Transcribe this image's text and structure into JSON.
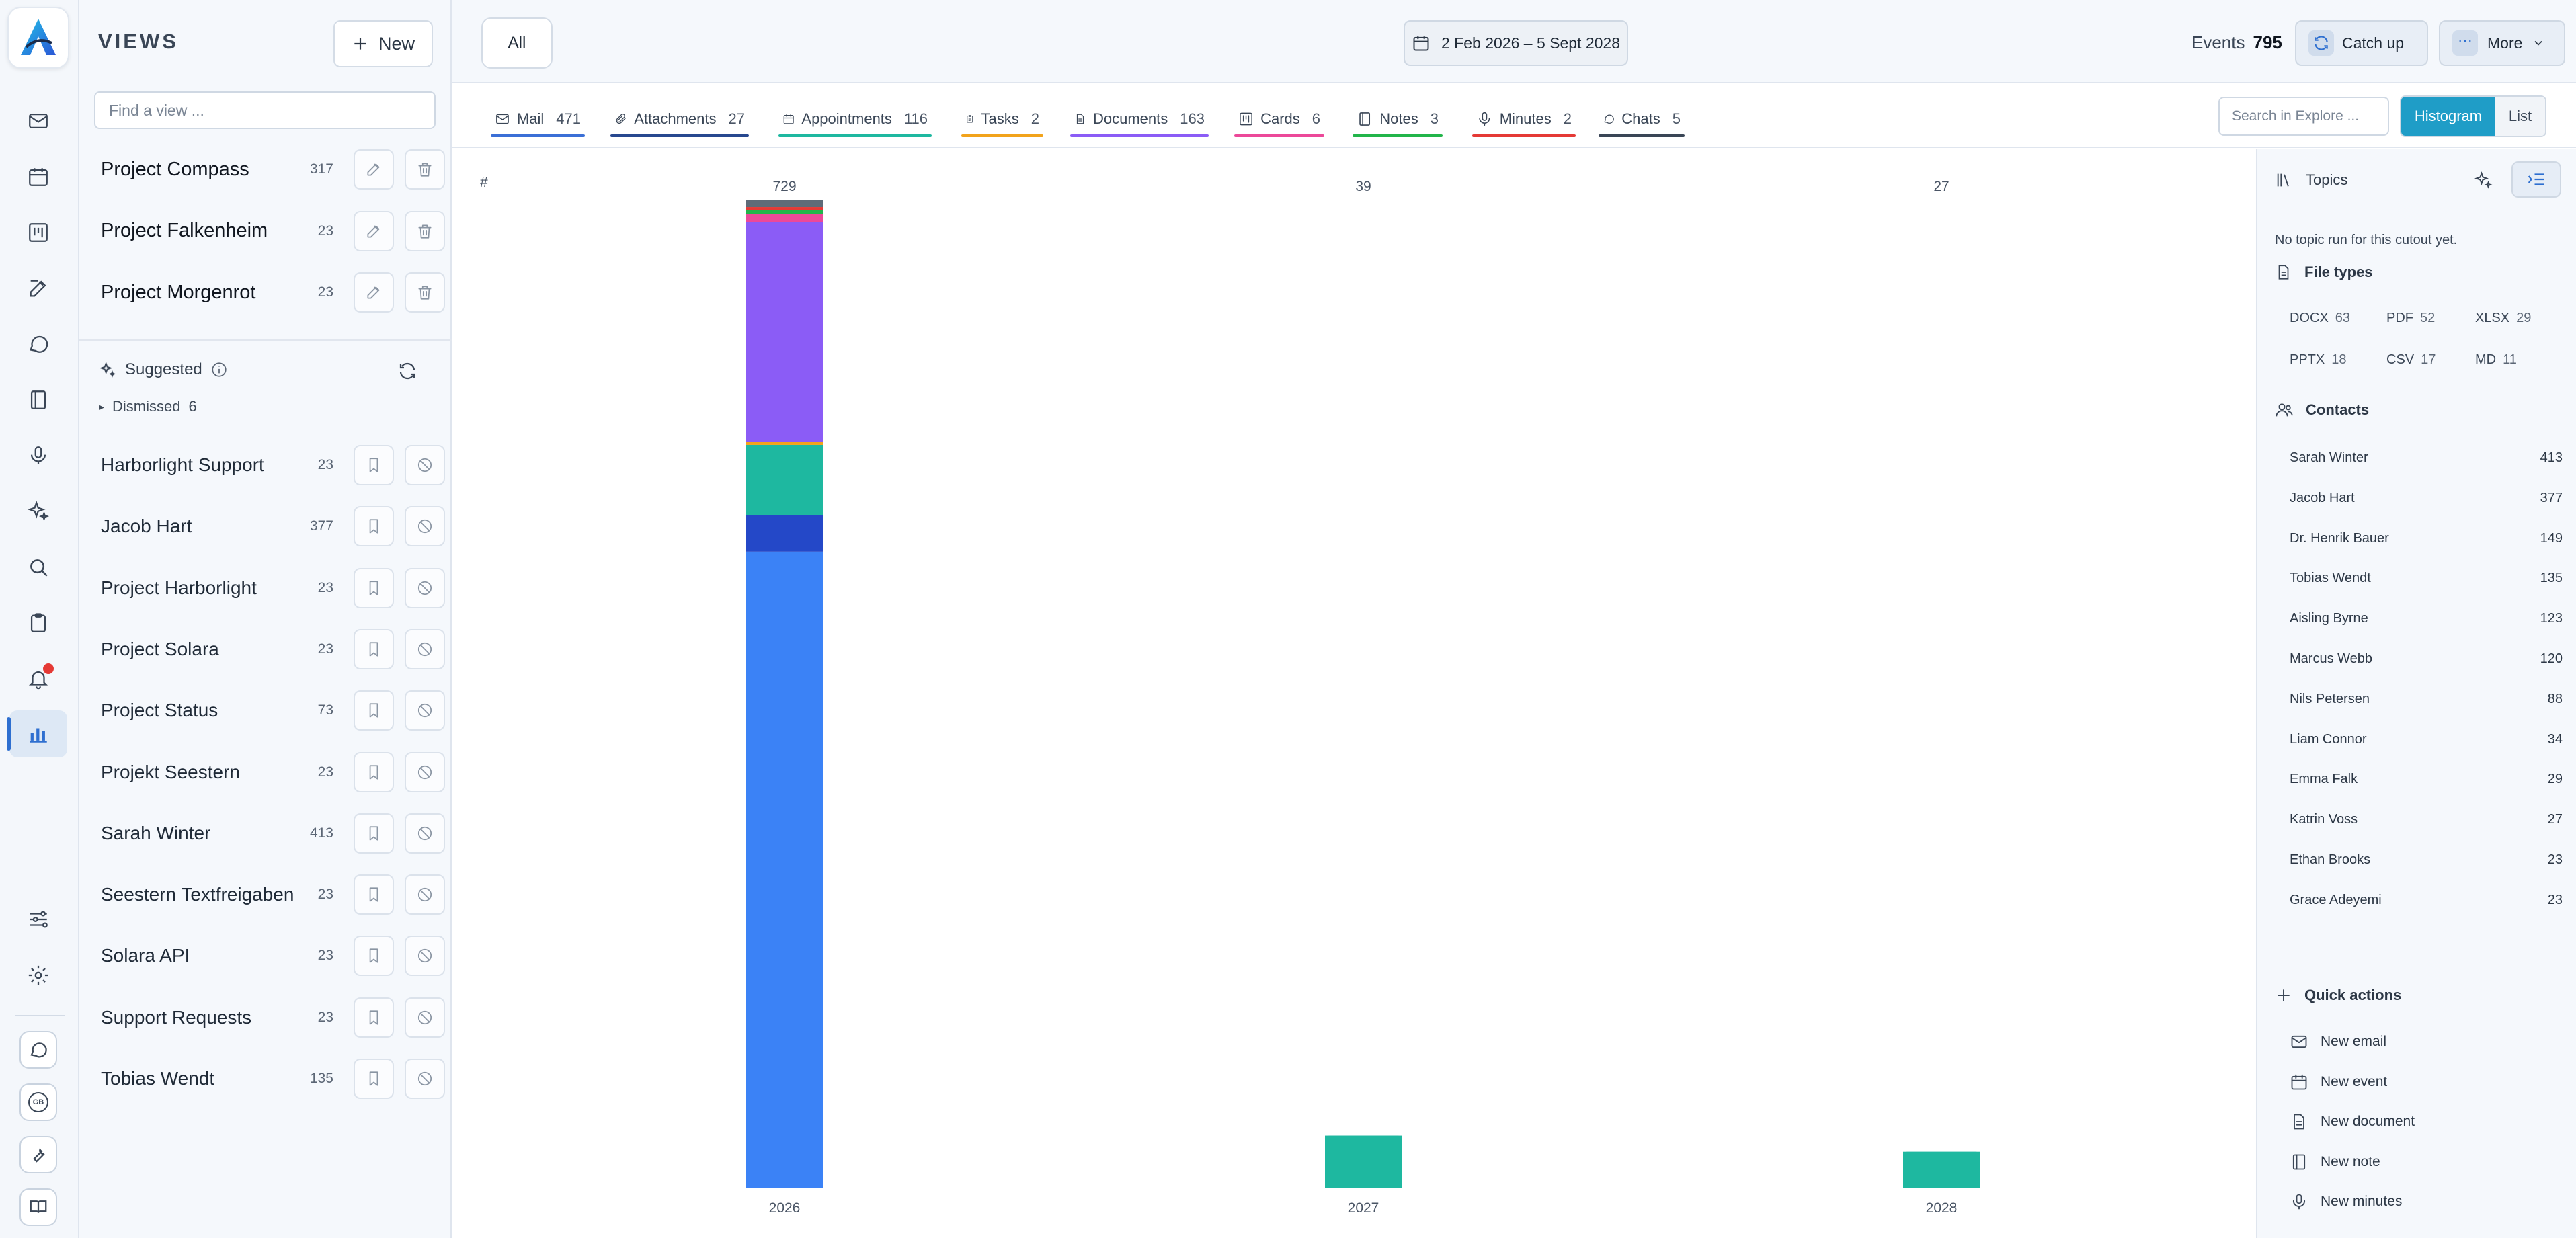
{
  "views": {
    "title": "VIEWS",
    "new_label": "New",
    "find_placeholder": "Find a view ...",
    "pinned": [
      {
        "name": "Project Compass",
        "count": "317"
      },
      {
        "name": "Project Falkenheim",
        "count": "23"
      },
      {
        "name": "Project Morgenrot",
        "count": "23"
      }
    ],
    "suggested_label": "Suggested",
    "dismissed_label": "Dismissed",
    "dismissed_count": "6",
    "suggested": [
      {
        "name": "Harborlight Support",
        "count": "23"
      },
      {
        "name": "Jacob Hart",
        "count": "377"
      },
      {
        "name": "Project Harborlight",
        "count": "23"
      },
      {
        "name": "Project Solara",
        "count": "23"
      },
      {
        "name": "Project Status",
        "count": "73"
      },
      {
        "name": "Projekt Seestern",
        "count": "23"
      },
      {
        "name": "Sarah Winter",
        "count": "413"
      },
      {
        "name": "Seestern Textfreigaben",
        "count": "23"
      },
      {
        "name": "Solara API",
        "count": "23"
      },
      {
        "name": "Support Requests",
        "count": "23"
      },
      {
        "name": "Tobias Wendt",
        "count": "135"
      }
    ]
  },
  "topbar": {
    "all_label": "All",
    "date_range": "2 Feb 2026 – 5 Sept 2028",
    "events_label": "Events",
    "events_count": "795",
    "catch_up_label": "Catch up",
    "more_label": "More"
  },
  "tabs": [
    {
      "label": "Mail",
      "count": "471",
      "color": "#3b6fd6",
      "icon": "mail-icon"
    },
    {
      "label": "Attachments",
      "count": "27",
      "color": "#27488f",
      "icon": "paperclip-icon"
    },
    {
      "label": "Appointments",
      "count": "116",
      "color": "#1eb8a0",
      "icon": "calendar-icon"
    },
    {
      "label": "Tasks",
      "count": "2",
      "color": "#f2a31b",
      "icon": "clipboard-icon"
    },
    {
      "label": "Documents",
      "count": "163",
      "color": "#8b5cf6",
      "icon": "document-icon"
    },
    {
      "label": "Cards",
      "count": "6",
      "color": "#ec4899",
      "icon": "kanban-icon"
    },
    {
      "label": "Notes",
      "count": "3",
      "color": "#22b54a",
      "icon": "notebook-icon"
    },
    {
      "label": "Minutes",
      "count": "2",
      "color": "#e53935",
      "icon": "microphone-icon"
    },
    {
      "label": "Chats",
      "count": "5",
      "color": "#3a4656",
      "icon": "chat-icon"
    }
  ],
  "explore_placeholder": "Search in Explore ...",
  "view_toggle": {
    "histogram": "Histogram",
    "list": "List"
  },
  "chart_data": {
    "type": "bar",
    "stacked": true,
    "y_axis_label": "#",
    "categories": [
      "2026",
      "2027",
      "2028"
    ],
    "totals": [
      "729",
      "39",
      "27"
    ],
    "series": [
      {
        "name": "Mail",
        "color": "#3b82f6",
        "values": [
          471,
          0,
          0
        ]
      },
      {
        "name": "Attachments",
        "color": "#2448c8",
        "values": [
          27,
          0,
          0
        ]
      },
      {
        "name": "Appointments",
        "color": "#1eb8a0",
        "values": [
          52,
          39,
          27
        ]
      },
      {
        "name": "Tasks",
        "color": "#f2a31b",
        "values": [
          2,
          0,
          0
        ]
      },
      {
        "name": "Documents",
        "color": "#8b5cf6",
        "values": [
          163,
          0,
          0
        ]
      },
      {
        "name": "Cards",
        "color": "#ec4899",
        "values": [
          6,
          0,
          0
        ]
      },
      {
        "name": "Notes",
        "color": "#22b54a",
        "values": [
          3,
          0,
          0
        ]
      },
      {
        "name": "Minutes",
        "color": "#e53935",
        "values": [
          2,
          0,
          0
        ]
      },
      {
        "name": "Chats",
        "color": "#5f6b78",
        "values": [
          5,
          0,
          0
        ]
      }
    ],
    "ylim": [
      0,
      729
    ]
  },
  "right": {
    "topics_label": "Topics",
    "no_topic_text": "No topic run for this cutout yet.",
    "file_types_label": "File types",
    "file_types": [
      {
        "type": "DOCX",
        "count": "63"
      },
      {
        "type": "PDF",
        "count": "52"
      },
      {
        "type": "XLSX",
        "count": "29"
      },
      {
        "type": "PPTX",
        "count": "18"
      },
      {
        "type": "CSV",
        "count": "17"
      },
      {
        "type": "MD",
        "count": "11"
      }
    ],
    "contacts_label": "Contacts",
    "contacts": [
      {
        "name": "Sarah Winter",
        "count": "413"
      },
      {
        "name": "Jacob Hart",
        "count": "377"
      },
      {
        "name": "Dr. Henrik Bauer",
        "count": "149"
      },
      {
        "name": "Tobias Wendt",
        "count": "135"
      },
      {
        "name": "Aisling Byrne",
        "count": "123"
      },
      {
        "name": "Marcus Webb",
        "count": "120"
      },
      {
        "name": "Nils Petersen",
        "count": "88"
      },
      {
        "name": "Liam Connor",
        "count": "34"
      },
      {
        "name": "Emma Falk",
        "count": "29"
      },
      {
        "name": "Katrin Voss",
        "count": "27"
      },
      {
        "name": "Ethan Brooks",
        "count": "23"
      },
      {
        "name": "Grace Adeyemi",
        "count": "23"
      }
    ],
    "quick_actions_label": "Quick actions",
    "quick_actions": [
      {
        "label": "New email",
        "icon": "mail-icon"
      },
      {
        "label": "New event",
        "icon": "calendar-icon"
      },
      {
        "label": "New document",
        "icon": "document-icon"
      },
      {
        "label": "New note",
        "icon": "notebook-icon"
      },
      {
        "label": "New minutes",
        "icon": "microphone-icon"
      }
    ]
  },
  "rail": {
    "logo_letter": "A",
    "badge_label": "GB",
    "icons": [
      "mail-icon",
      "calendar-icon",
      "kanban-icon",
      "edit-icon",
      "chat-icon",
      "notebook-icon",
      "microphone-icon",
      "sparkle-icon",
      "search-icon",
      "clipboard-icon",
      "bell-icon",
      "bar-chart-icon",
      "sliders-icon",
      "gear-icon",
      "support-chat-icon",
      "language-badge-icon",
      "wrench-icon",
      "book-icon"
    ]
  }
}
